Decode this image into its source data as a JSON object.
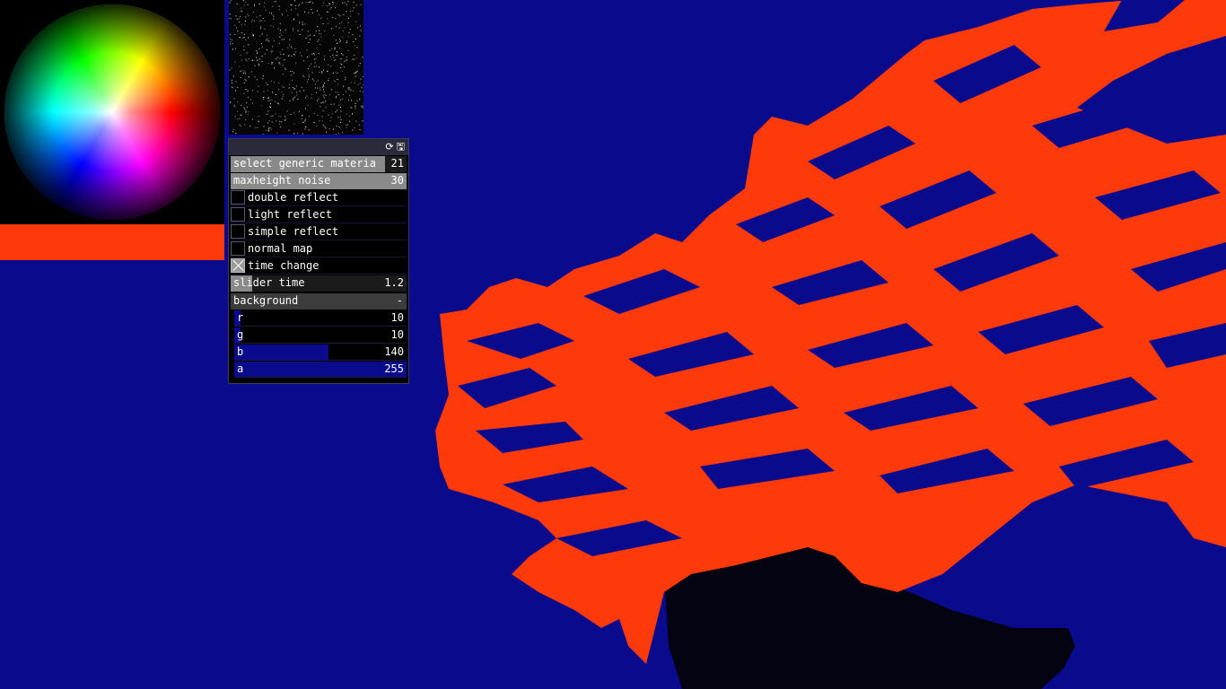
{
  "colors": {
    "background": "#0a0a8c",
    "mesh_primary": "#ff3a0a",
    "mesh_secondary": "#0a0a8c",
    "selected_swatch": "#ff3a0a",
    "slider_fill": "#8a8a8a",
    "channel_fill": "#0a0a8c"
  },
  "color_picker": {
    "selected_color": "#ff3a0a"
  },
  "gui": {
    "header_icons": [
      "refresh-icon",
      "save-icon"
    ],
    "controls": {
      "select_generic_material": {
        "label": "select generic materia",
        "value": "21",
        "fraction": 0.875
      },
      "maxheight_noise": {
        "label": "maxheight noise",
        "value": "30",
        "fraction": 1.0
      },
      "double_reflect": {
        "label": "double reflect",
        "checked": false
      },
      "light_reflect": {
        "label": "light reflect",
        "checked": false
      },
      "simple_reflect": {
        "label": "simple reflect",
        "checked": false
      },
      "normal_map": {
        "label": "normal map",
        "checked": false
      },
      "time_change": {
        "label": "time change",
        "checked": true
      },
      "slider_time": {
        "label": "slider time",
        "value": "1.2",
        "fraction": 0.12
      }
    },
    "background_group": {
      "title": "background",
      "collapse_symbol": "-",
      "channels": [
        {
          "label": "r",
          "value": "10",
          "fraction": 0.039
        },
        {
          "label": "g",
          "value": "10",
          "fraction": 0.039
        },
        {
          "label": "b",
          "value": "140",
          "fraction": 0.549
        },
        {
          "label": "a",
          "value": "255",
          "fraction": 1.0
        }
      ]
    }
  }
}
